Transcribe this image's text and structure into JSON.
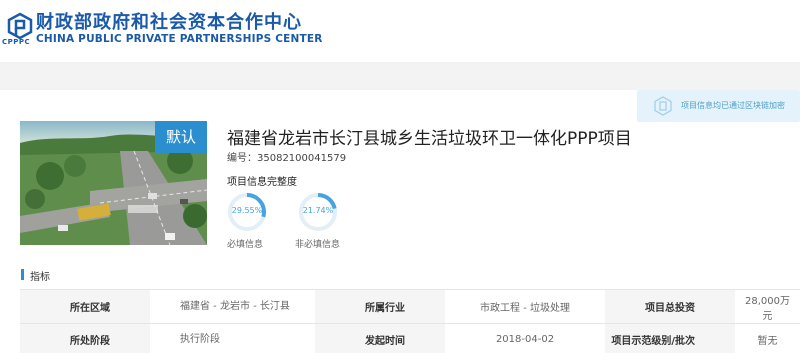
{
  "header": {
    "org_name_cn": "财政部政府和社会资本合作中心",
    "org_name_en": "CHINA PUBLIC PRIVATE PARTNERSHIPS CENTER",
    "logo_text": "CPPPC",
    "logo_icon": "cpppc-logo-icon"
  },
  "chain_badge": {
    "text": "项目信息均已通过区块链加密",
    "icon": "blockchain-icon"
  },
  "project": {
    "default_tag": "默认",
    "title": "福建省龙岩市长汀县城乡生活垃圾环卫一体化PPP项目",
    "code": "编号：35082100041579",
    "completeness_label": "项目信息完整度",
    "required": {
      "value": "29.55%",
      "fraction": 0.2955,
      "label": "必填信息"
    },
    "optional": {
      "value": "21.74%",
      "fraction": 0.2174,
      "label": "非必填信息"
    },
    "ring_color": "#47a3dd",
    "ring_track_color": "#e3eef6"
  },
  "section": {
    "title": "指标"
  },
  "table": {
    "rows": [
      [
        {
          "k": "所在区域",
          "v": "福建省 - 龙岩市 - 长汀县"
        },
        {
          "k": "所属行业",
          "v": "市政工程 - 垃圾处理"
        },
        {
          "k": "项目总投资",
          "v": "28,000万元"
        }
      ],
      [
        {
          "k": "所处阶段",
          "v": "执行阶段"
        },
        {
          "k": "发起时间",
          "v": "2018-04-02"
        },
        {
          "k": "项目示范级别/批次",
          "v": "暂无"
        }
      ]
    ]
  },
  "colors": {
    "brand": "#1a5aa8",
    "accent": "#2b8fcf"
  }
}
